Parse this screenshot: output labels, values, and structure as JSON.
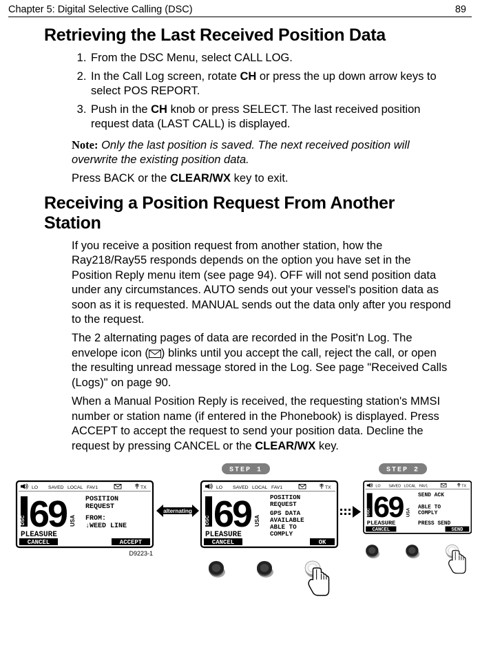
{
  "runhead": {
    "chapter": "Chapter 5: Digital Selective Calling (DSC)",
    "page": "89"
  },
  "section1": {
    "title": "Retrieving the Last Received Position Data",
    "steps": [
      {
        "pre": "From the DSC Menu, select CALL LOG."
      },
      {
        "pre": "In the Call Log screen, rotate ",
        "kw": "CH",
        "post": " or press the up down arrow keys to select POS REPORT."
      },
      {
        "pre": "Push in the ",
        "kw": "CH",
        "post": " knob or press SELECT. The last received position request data (LAST CALL) is displayed."
      }
    ],
    "note": {
      "label": "Note:",
      "text": "  Only the last position is saved. The next received position will overwrite the existing position data."
    },
    "exit": {
      "pre": "Press BACK or the ",
      "kw": "CLEAR/WX",
      "post": " key to exit."
    }
  },
  "section2": {
    "title": "Receiving a Position Request From Another Station",
    "p1": "If you receive a position request from another station, how the Ray218/Ray55 responds depends on the option you have set in the Position Reply menu item (see page 94). OFF will not send position data under any circumstances. AUTO sends out your vessel's position data as soon as it is requested. MANUAL sends out the data only after you respond to the request.",
    "p2a": "The 2 alternating pages of data are recorded in the Posit'n Log. The envelope icon (",
    "p2b": ") blinks until you accept the call, reject the call, or open the resulting unread message stored in the Log. See page \"Received Calls (Logs)\" on page 90.",
    "p3": {
      "pre": "When a Manual Position Reply is received, the requesting station's MMSI number or station name (if entered in the Phonebook) is displayed. Press ACCEPT to accept the request to send your position data. Decline the request by pressing CANCEL or the ",
      "kw": "CLEAR/WX",
      "post": " key."
    }
  },
  "fig": {
    "step1": "STEP 1",
    "step2": "STEP 2",
    "alt": "alternating",
    "figref": "D9223-1",
    "statusbar": {
      "lo": "LO",
      "saved": "SAVED",
      "local": "LOCAL",
      "fav": "FAV1"
    },
    "dsc_label": "DSC",
    "channel": "69",
    "usa": "USA",
    "category": "PLEASURE",
    "screen1": {
      "l1": "POSITION",
      "l2": "REQUEST",
      "l3": "FROM:",
      "l4": "↓WEED LINE",
      "left": "CANCEL",
      "right": "ACCEPT"
    },
    "screen2": {
      "l1": "POSITION",
      "l2": "REQUEST",
      "l3": "GPS DATA",
      "l4": "AVAILABLE",
      "l5": "ABLE TO",
      "l6": "COMPLY",
      "left": "CANCEL",
      "right": "OK"
    },
    "screen3": {
      "l1": "SEND ACK",
      "l3": "ABLE TO",
      "l4": "COMPLY",
      "l6": "PRESS SEND",
      "left": "CANCEL",
      "right": "SEND"
    }
  }
}
